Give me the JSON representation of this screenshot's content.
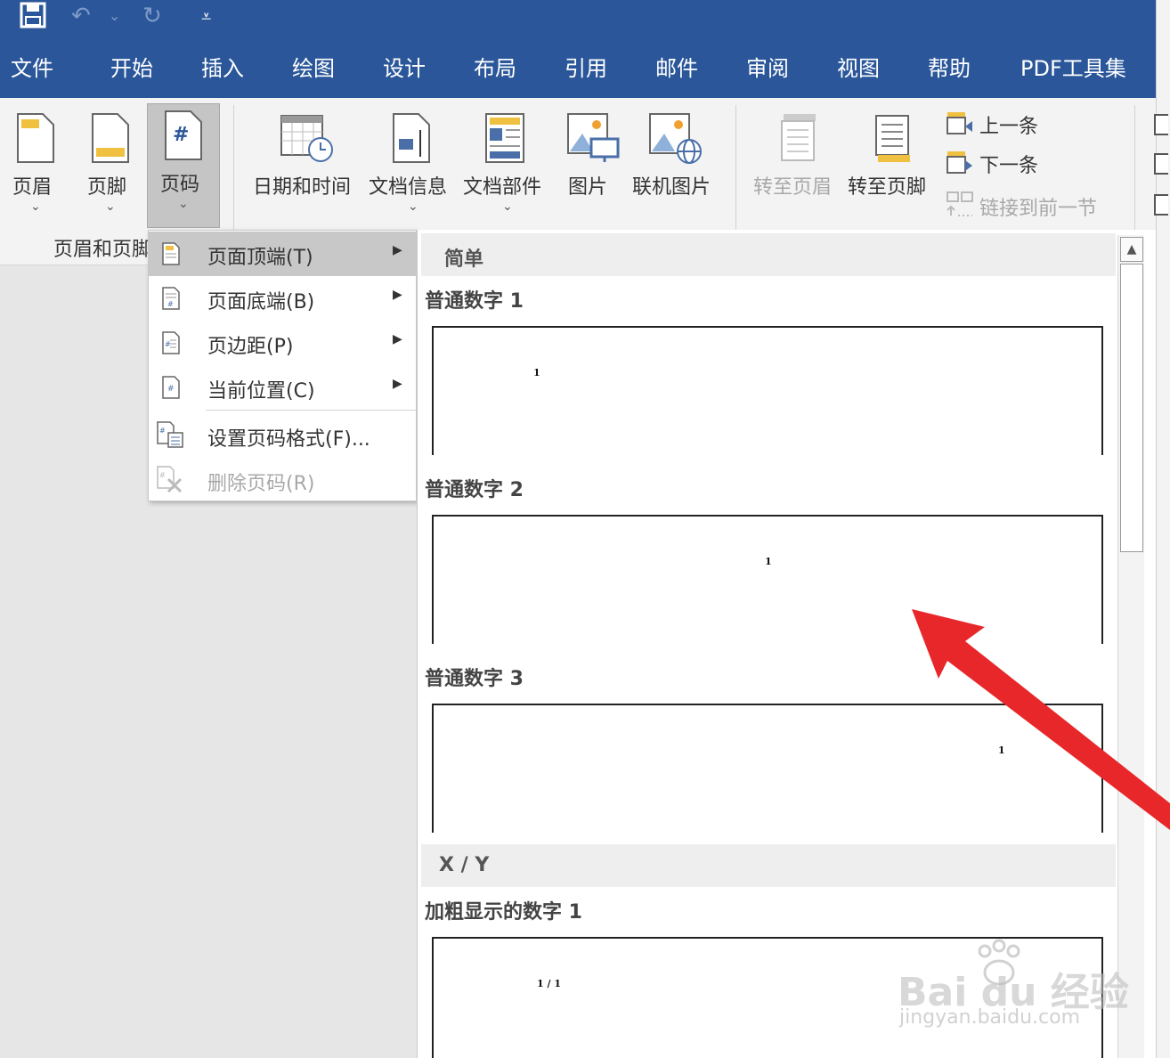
{
  "quick_access": {
    "save": "save-icon",
    "undo": "↶",
    "undo_dropdown": "⌄",
    "redo": "↻",
    "customize": "⩡"
  },
  "tabs": [
    "文件",
    "开始",
    "插入",
    "绘图",
    "设计",
    "布局",
    "引用",
    "邮件",
    "审阅",
    "视图",
    "帮助",
    "PDF工具集"
  ],
  "ribbon": {
    "header": "页眉",
    "footer": "页脚",
    "page_number": "页码",
    "date_time": "日期和时间",
    "doc_info": "文档信息",
    "doc_parts": "文档部件",
    "picture": "图片",
    "online_picture": "联机图片",
    "goto_header": "转至页眉",
    "goto_footer": "转至页脚",
    "previous": "上一条",
    "next": "下一条",
    "link_previous": "链接到前一节",
    "group_label": "页眉和页脚",
    "chevron": "⌄",
    "page_number_glyph": "#"
  },
  "menu": {
    "items": [
      {
        "label": "页面顶端(T)",
        "icon": "page-top-icon",
        "submenu": true,
        "highlighted": true,
        "disabled": false
      },
      {
        "label": "页面底端(B)",
        "icon": "page-bottom-icon",
        "submenu": true,
        "highlighted": false,
        "disabled": false
      },
      {
        "label": "页边距(P)",
        "icon": "page-margin-icon",
        "submenu": true,
        "highlighted": false,
        "disabled": false
      },
      {
        "label": "当前位置(C)",
        "icon": "current-position-icon",
        "submenu": true,
        "highlighted": false,
        "disabled": false
      },
      {
        "label": "设置页码格式(F)...",
        "icon": "format-page-number-icon",
        "submenu": false,
        "highlighted": false,
        "disabled": false
      },
      {
        "label": "删除页码(R)",
        "icon": "remove-page-number-icon",
        "submenu": false,
        "highlighted": false,
        "disabled": true
      }
    ],
    "arrow": "▶"
  },
  "gallery": {
    "section_simple": "简单",
    "section_xy": "X / Y",
    "items": [
      {
        "label": "普通数字 1",
        "preview": "1"
      },
      {
        "label": "普通数字 2",
        "preview": "1"
      },
      {
        "label": "普通数字 3",
        "preview": "1"
      },
      {
        "label": "加粗显示的数字 1",
        "preview": "1 / 1"
      }
    ],
    "scroll_up": "▲"
  },
  "watermark": {
    "brand": "Bai du 经验",
    "url": "jingyan.baidu.com"
  },
  "colors": {
    "title_bar": "#2b579a",
    "ribbon_bg": "#f3f3f3",
    "highlight": "#c8c8c8",
    "annotation_arrow": "#e8272a"
  }
}
